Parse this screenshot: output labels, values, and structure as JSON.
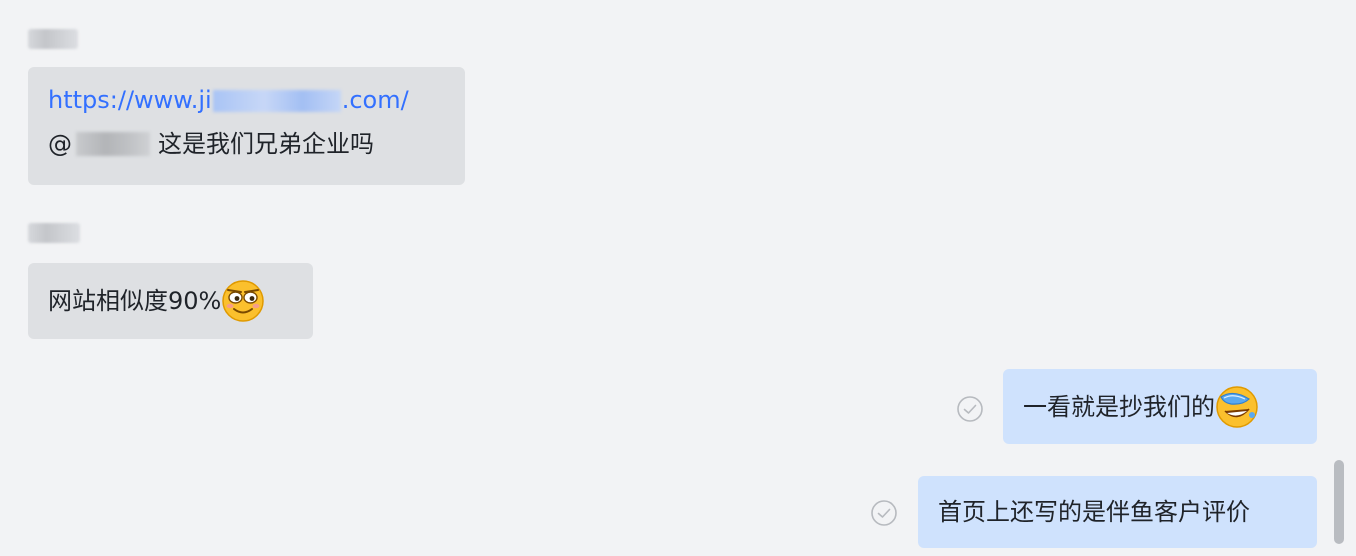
{
  "messages": [
    {
      "direction": "incoming",
      "link_prefix": "https://www.ji",
      "link_suffix": ".com/",
      "mention_prefix": "@",
      "text": "这是我们兄弟企业吗"
    },
    {
      "direction": "incoming",
      "text": "网站相似度90%",
      "emoji": "smirk-emoji"
    },
    {
      "direction": "outgoing",
      "text": "一看就是抄我们的",
      "emoji": "facepalm-laugh-emoji"
    },
    {
      "direction": "outgoing",
      "text": "首页上还写的是伴鱼客户评价"
    }
  ],
  "colors": {
    "background": "#f2f3f5",
    "incoming_bubble": "#dee0e3",
    "outgoing_bubble": "#cfe2fd",
    "link": "#3370ff",
    "text": "#1f2329"
  }
}
